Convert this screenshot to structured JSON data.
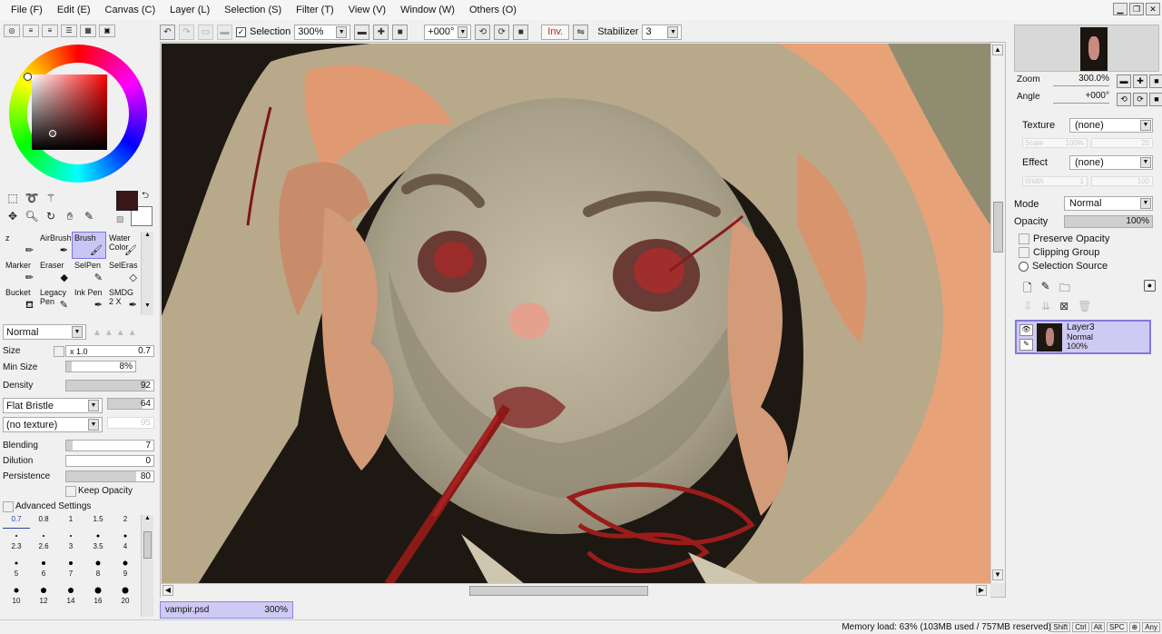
{
  "menu": [
    "File (F)",
    "Edit (E)",
    "Canvas (C)",
    "Layer (L)",
    "Selection (S)",
    "Filter (T)",
    "View (V)",
    "Window (W)",
    "Others (O)"
  ],
  "toolbar": {
    "selection_label": "Selection",
    "zoom": "300%",
    "angle": "+000°",
    "inv_label": "Inv.",
    "stabilizer_label": "Stabilizer",
    "stabilizer_value": "3"
  },
  "colors": {
    "foreground": "#3a1616",
    "background": "#ffffff",
    "accent": "#cfcaf3"
  },
  "brushes": [
    {
      "label": "z",
      "icon": "pencil-icon"
    },
    {
      "label": "AirBrush",
      "icon": "airbrush-icon"
    },
    {
      "label": "Brush",
      "icon": "brush-icon",
      "selected": true
    },
    {
      "label": "Water Color",
      "icon": "watercolor-icon"
    },
    {
      "label": "Marker",
      "icon": "marker-icon"
    },
    {
      "label": "Eraser",
      "icon": "eraser-icon"
    },
    {
      "label": "SelPen",
      "icon": "selpen-icon"
    },
    {
      "label": "SelEras",
      "icon": "seleras-icon"
    },
    {
      "label": "Bucket",
      "icon": "bucket-icon"
    },
    {
      "label": "Legacy Pen",
      "icon": "legacy-pen-icon"
    },
    {
      "label": "Ink Pen",
      "icon": "ink-pen-icon"
    },
    {
      "label": "SMDG 2 X",
      "icon": "smdg-icon"
    }
  ],
  "brush_settings": {
    "mode": "Normal",
    "size_label": "Size",
    "size_mult": "x 1.0",
    "size_value": "0.7",
    "min_size_label": "Min Size",
    "min_size_value": "8%",
    "min_size_level": 0.08,
    "density_label": "Density",
    "density_value": "92",
    "density_level": 0.92,
    "shape": "Flat Bristle",
    "shape_value": "64",
    "texture": "(no texture)",
    "texture_value": "95",
    "blending_label": "Blending",
    "blending_value": "7",
    "blending_level": 0.07,
    "dilution_label": "Dilution",
    "dilution_value": "0",
    "dilution_level": 0,
    "persistence_label": "Persistence",
    "persistence_value": "80",
    "persistence_level": 0.8,
    "keep_opacity": "Keep Opacity",
    "advanced": "Advanced Settings"
  },
  "sizes": [
    "0.7",
    "0.8",
    "1",
    "1.5",
    "2",
    "2.3",
    "2.6",
    "3",
    "3.5",
    "4",
    "5",
    "6",
    "7",
    "8",
    "9",
    "10",
    "12",
    "14",
    "16",
    "20"
  ],
  "document": {
    "name": "vampir.psd",
    "zoom": "300%"
  },
  "navigator": {
    "zoom_label": "Zoom",
    "zoom_value": "300.0%",
    "angle_label": "Angle",
    "angle_value": "+000°"
  },
  "layer_props": {
    "texture_label": "Texture",
    "texture_value": "(none)",
    "effect_label": "Effect",
    "effect_value": "(none)",
    "mode_label": "Mode",
    "mode_value": "Normal",
    "opacity_label": "Opacity",
    "opacity_value": "100%",
    "preserve_opacity": "Preserve Opacity",
    "clipping_group": "Clipping Group",
    "selection_source": "Selection Source",
    "ghost_scale": "Scale",
    "ghost_scale_val": "100%",
    "ghost_20": "20",
    "ghost_width": "Width",
    "ghost_width_val": "1",
    "ghost_100": "100"
  },
  "layers": [
    {
      "name": "Layer3",
      "mode": "Normal",
      "opacity": "100%"
    }
  ],
  "status": {
    "memory": "Memory load: 63% (103MB used / 757MB reserved)",
    "keys": [
      "Shift",
      "Ctrl",
      "Alt",
      "SPC",
      "⊕",
      "Any"
    ]
  }
}
